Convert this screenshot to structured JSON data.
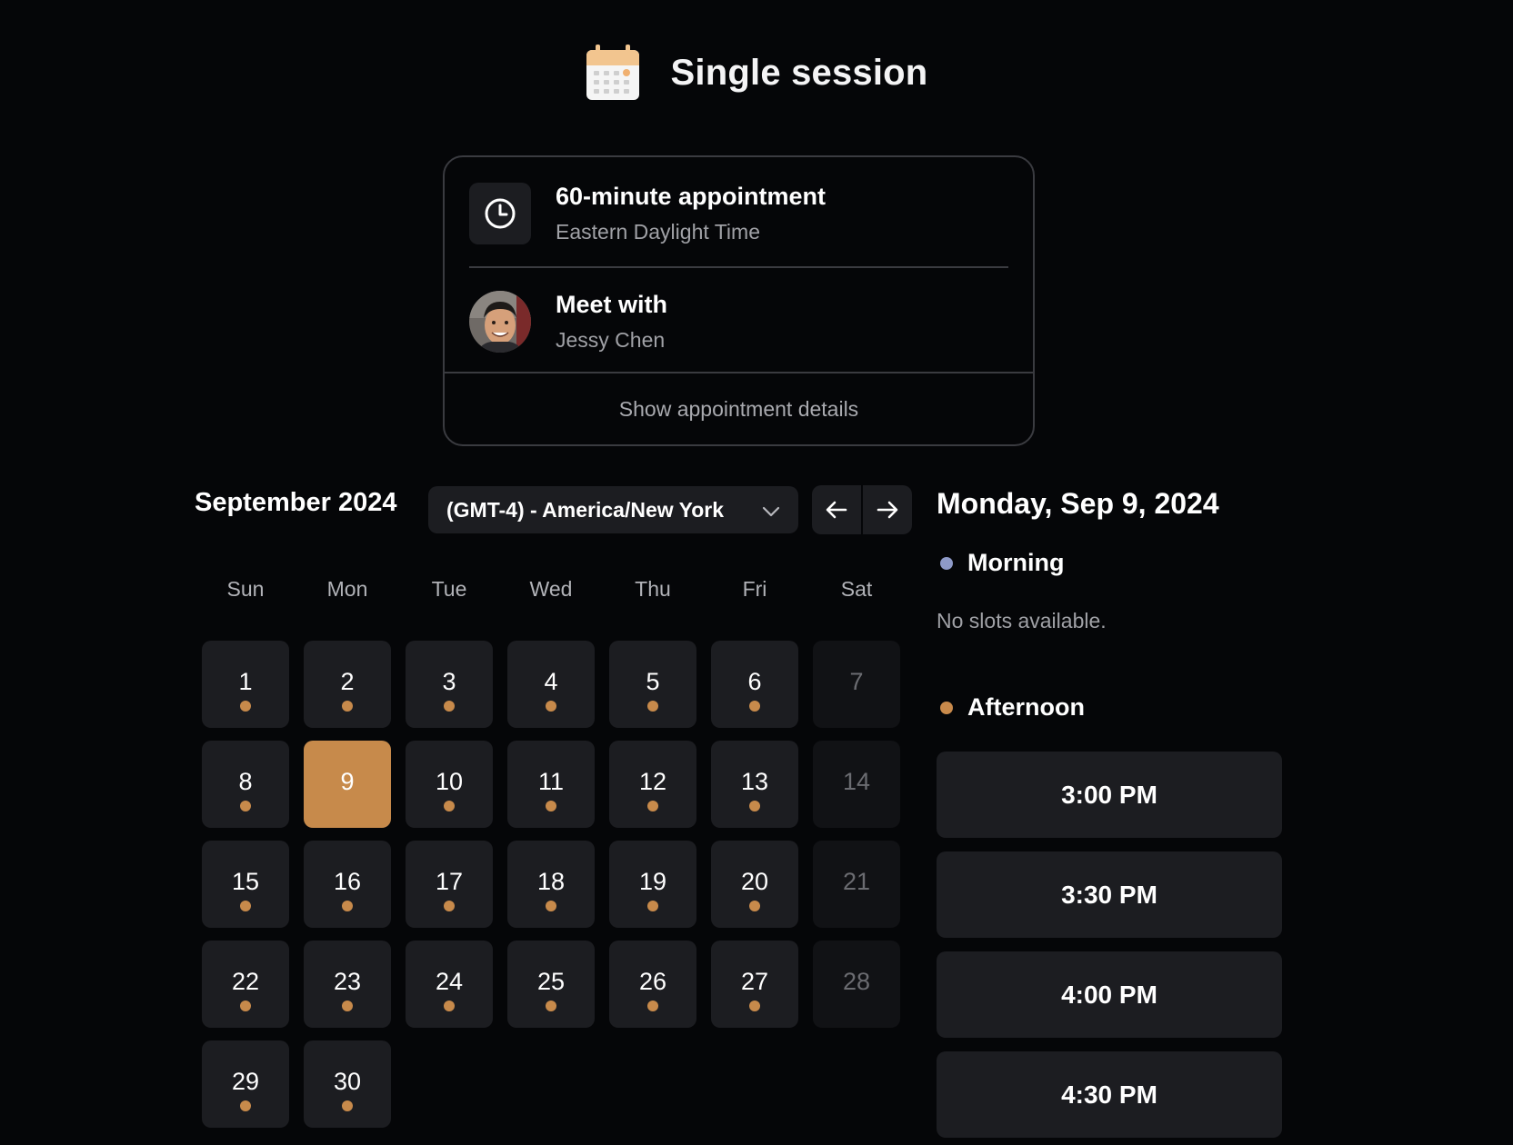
{
  "header": {
    "title": "Single session",
    "icon": "calendar-icon"
  },
  "appointment": {
    "duration_label": "60-minute appointment",
    "timezone_label": "Eastern Daylight Time",
    "meet_label": "Meet with",
    "host_name": "Jessy Chen",
    "details_link": "Show appointment details"
  },
  "calendar": {
    "month_label": "September 2024",
    "timezone_select": "(GMT-4) - America/New York",
    "weekdays": [
      "Sun",
      "Mon",
      "Tue",
      "Wed",
      "Thu",
      "Fri",
      "Sat"
    ],
    "selected_day": 9,
    "days": [
      {
        "num": "1",
        "available": true
      },
      {
        "num": "2",
        "available": true
      },
      {
        "num": "3",
        "available": true
      },
      {
        "num": "4",
        "available": true
      },
      {
        "num": "5",
        "available": true
      },
      {
        "num": "6",
        "available": true
      },
      {
        "num": "7",
        "available": false
      },
      {
        "num": "8",
        "available": true
      },
      {
        "num": "9",
        "available": true
      },
      {
        "num": "10",
        "available": true
      },
      {
        "num": "11",
        "available": true
      },
      {
        "num": "12",
        "available": true
      },
      {
        "num": "13",
        "available": true
      },
      {
        "num": "14",
        "available": false
      },
      {
        "num": "15",
        "available": true
      },
      {
        "num": "16",
        "available": true
      },
      {
        "num": "17",
        "available": true
      },
      {
        "num": "18",
        "available": true
      },
      {
        "num": "19",
        "available": true
      },
      {
        "num": "20",
        "available": true
      },
      {
        "num": "21",
        "available": false
      },
      {
        "num": "22",
        "available": true
      },
      {
        "num": "23",
        "available": true
      },
      {
        "num": "24",
        "available": true
      },
      {
        "num": "25",
        "available": true
      },
      {
        "num": "26",
        "available": true
      },
      {
        "num": "27",
        "available": true
      },
      {
        "num": "28",
        "available": false
      },
      {
        "num": "29",
        "available": true
      },
      {
        "num": "30",
        "available": true
      }
    ]
  },
  "schedule": {
    "date_heading": "Monday, Sep 9, 2024",
    "morning_label": "Morning",
    "morning_color": "#8e9ac8",
    "no_slots": "No slots available.",
    "afternoon_label": "Afternoon",
    "afternoon_color": "#c98a4b",
    "slots": [
      "3:00 PM",
      "3:30 PM",
      "4:00 PM",
      "4:30 PM"
    ]
  },
  "colors": {
    "accent": "#c78a4b",
    "background": "#050608",
    "surface": "#1c1d21"
  }
}
